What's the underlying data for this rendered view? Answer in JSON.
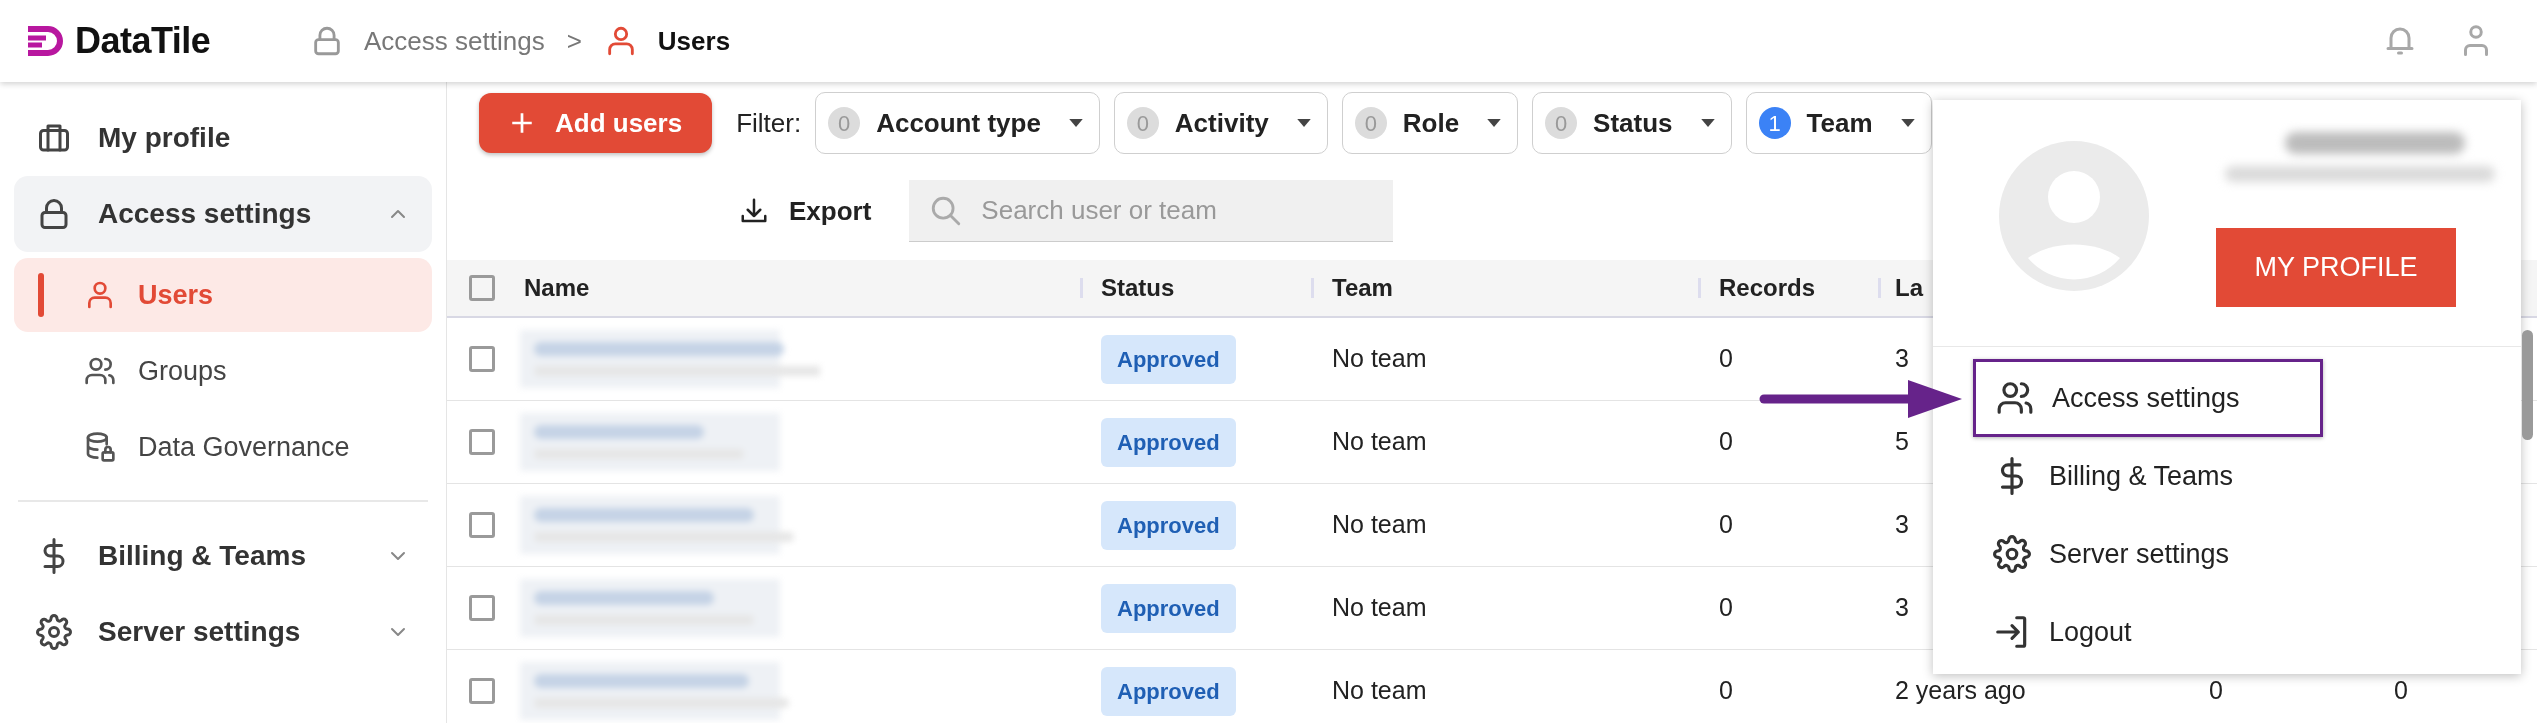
{
  "header": {
    "logo": "DataTile",
    "breadcrumb": [
      {
        "label": "Access settings",
        "current": false
      },
      {
        "label": "Users",
        "current": true
      }
    ],
    "separator": ">"
  },
  "sidebar": {
    "items": [
      {
        "label": "My profile"
      },
      {
        "label": "Access settings",
        "expanded": true,
        "children": [
          {
            "label": "Users",
            "selected": true
          },
          {
            "label": "Groups",
            "selected": false
          },
          {
            "label": "Data Governance",
            "selected": false
          }
        ]
      },
      {
        "label": "Billing & Teams",
        "expanded": false
      },
      {
        "label": "Server settings",
        "expanded": false
      }
    ]
  },
  "toolbar": {
    "add_button": "Add users",
    "filter_label": "Filter:",
    "filters": [
      {
        "label": "Account type",
        "count": "0",
        "active": false
      },
      {
        "label": "Activity",
        "count": "0",
        "active": false
      },
      {
        "label": "Role",
        "count": "0",
        "active": false
      },
      {
        "label": "Status",
        "count": "0",
        "active": false
      },
      {
        "label": "Team",
        "count": "1",
        "active": true
      }
    ],
    "export": "Export",
    "search": {
      "placeholder": "Search user or team"
    }
  },
  "table": {
    "select_all_checked": false,
    "columns": [
      "Name",
      "Status",
      "Team",
      "Records",
      "La"
    ],
    "rows": [
      {
        "checked": false,
        "status": "Approved",
        "team": "No team",
        "records": "0",
        "column_5": "3"
      },
      {
        "checked": false,
        "status": "Approved",
        "team": "No team",
        "records": "0",
        "column_5": "5"
      },
      {
        "checked": false,
        "status": "Approved",
        "team": "No team",
        "records": "0",
        "column_5": "3"
      },
      {
        "checked": false,
        "status": "Approved",
        "team": "No team",
        "records": "0",
        "column_5": "3"
      },
      {
        "checked": false,
        "status": "Approved",
        "team": "No team",
        "records": "0",
        "column_5": "2 years ago",
        "column_7": "0",
        "column_8": "0"
      }
    ]
  },
  "profile_menu": {
    "button": "MY PROFILE",
    "items": [
      {
        "label": "Access settings",
        "highlighted": true
      },
      {
        "label": "Billing & Teams",
        "highlighted": false
      },
      {
        "label": "Server settings",
        "highlighted": false
      },
      {
        "label": "Logout",
        "highlighted": false
      }
    ]
  }
}
